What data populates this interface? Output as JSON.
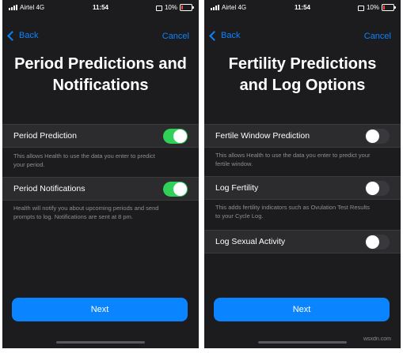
{
  "status": {
    "carrier": "Airtel 4G",
    "time": "11:54",
    "battery": "10%"
  },
  "colors": {
    "accent": "#0a84ff",
    "toggle_on": "#30d158",
    "toggle_off": "#39393d",
    "background": "#1c1c1e",
    "row_background": "#2c2c2e"
  },
  "left_screen": {
    "back_label": "Back",
    "cancel_label": "Cancel",
    "title_line1": "Period Predictions and",
    "title_line2": "Notifications",
    "rows": [
      {
        "label": "Period Prediction",
        "toggle_on": true,
        "description_line1": "This allows Health to use the data you enter to predict",
        "description_line2": "your period."
      },
      {
        "label": "Period Notifications",
        "toggle_on": true,
        "description_line1": "Health will notify you about upcoming periods and send",
        "description_line2": "prompts to log. Notifications are sent at 8 pm."
      }
    ],
    "next_label": "Next"
  },
  "right_screen": {
    "back_label": "Back",
    "cancel_label": "Cancel",
    "title_line1": "Fertility Predictions",
    "title_line2": "and Log Options",
    "rows": [
      {
        "label": "Fertile Window Prediction",
        "toggle_on": false,
        "description_line1": "This allows Health to use the data you enter to predict your",
        "description_line2": "fertile window."
      },
      {
        "label": "Log Fertility",
        "toggle_on": false,
        "description_line1": "This adds fertility indicators such as Ovulation Test Results",
        "description_line2": "to your Cycle Log."
      },
      {
        "label": "Log Sexual Activity",
        "toggle_on": false
      }
    ],
    "next_label": "Next"
  },
  "watermark": "wsxdn.com"
}
